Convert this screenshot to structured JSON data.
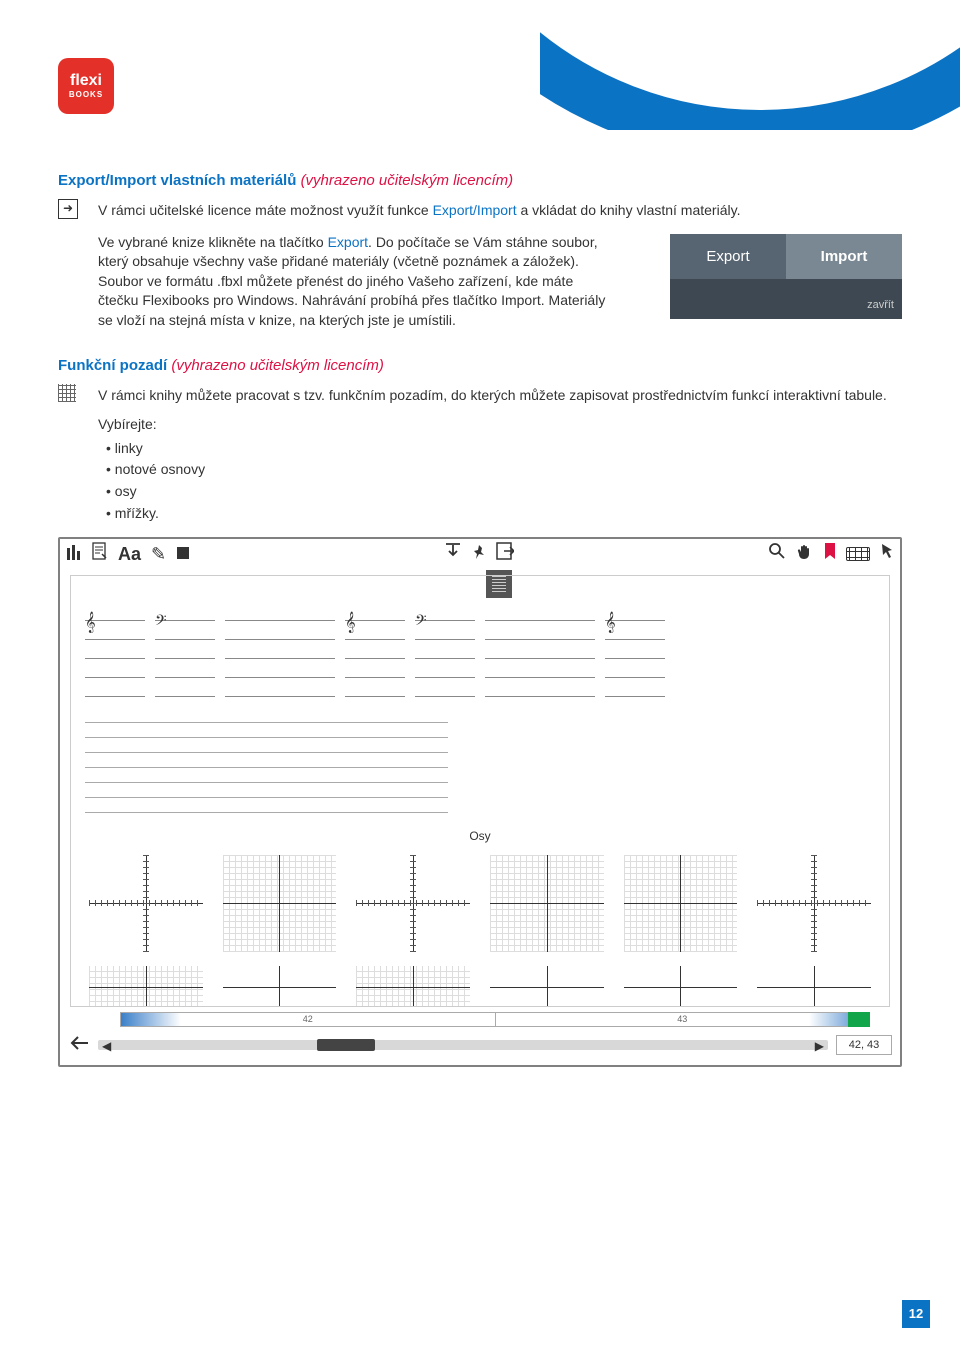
{
  "logo": {
    "main": "flexi",
    "sub": "BOOKS"
  },
  "sec1": {
    "title_blue": "Export/Import vlastních materiálů",
    "title_red": "(vyhrazeno učitelským licencím)",
    "p1_a": "V rámci učitelské licence máte možnost využít funkce ",
    "p1_link": "Export/Import",
    "p1_b": " a vkládat do knihy vlastní materiály.",
    "p2_a": "Ve vybrané knize klikněte na tlačítko ",
    "p2_link": "Export",
    "p2_b": ". Do počítače se Vám stáhne soubor, který obsahuje všechny vaše přidané materiály (včetně poznámek a záložek). Soubor ve formátu .fbxl můžete přenést do jiného Vašeho zařízení, kde máte čtečku Flexibooks pro Windows. Nahrávání probíhá přes tlačítko Import. Materiály se vloží na stejná místa v knize, na kterých jste je umístili.",
    "card": {
      "export": "Export",
      "import": "Import",
      "close": "zavřít"
    }
  },
  "sec2": {
    "title_blue": "Funkční pozadí",
    "title_red": "(vyhrazeno učitelským licencím)",
    "p1": "V rámci knihy můžete pracovat s tzv. funkčním pozadím, do kterých můžete zapisovat prostřednictvím funkcí interaktivní tabule.",
    "select_label": "Vybírejte:",
    "items": [
      "linky",
      "notové osnovy",
      "osy",
      "mřížky."
    ]
  },
  "app": {
    "osy_label": "Osy",
    "ruler": {
      "left": "42",
      "right": "43"
    },
    "page_indicator": "42, 43",
    "toolbar": {
      "Aa": "Aa"
    }
  },
  "page_number": "12"
}
